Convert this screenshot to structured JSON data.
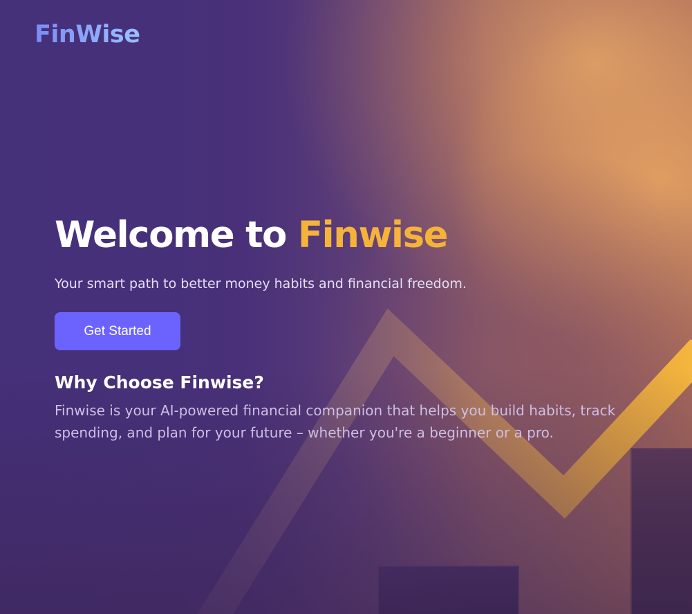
{
  "brand": {
    "logo_text": "FinWise"
  },
  "hero": {
    "title_prefix": "Welcome to ",
    "title_accent": "Finwise",
    "subtitle": "Your smart path to better money habits and financial freedom.",
    "cta_label": "Get Started"
  },
  "why": {
    "heading": "Why Choose Finwise?",
    "body": "Finwise is your AI-powered financial companion that helps you build habits, track spending, and plan for your future – whether you're a beginner or a pro."
  },
  "colors": {
    "background": "#4a2f78",
    "accent": "#f6b33a",
    "button": "#6c63ff",
    "logo": "#8fb0ff"
  },
  "background_image": {
    "icon": "rising-trend-chart-illustration"
  }
}
